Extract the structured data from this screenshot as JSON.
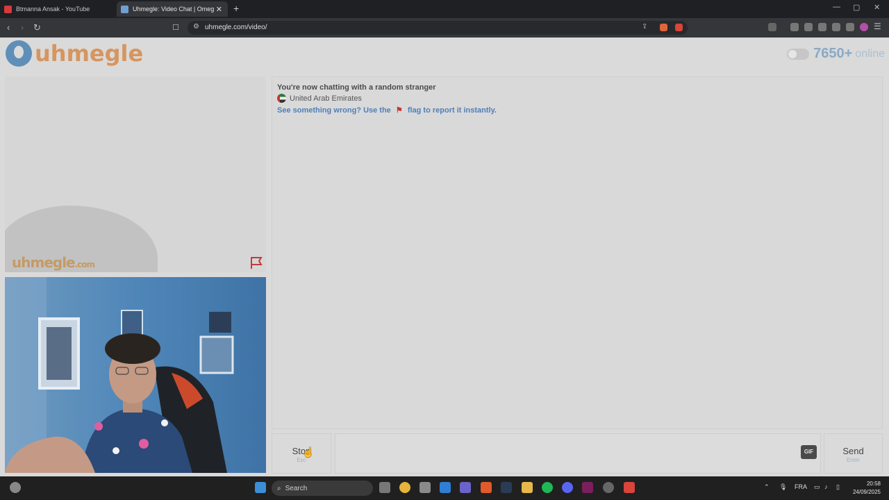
{
  "browser": {
    "tabs": [
      {
        "label": "Btmanna Ansak - YouTube",
        "active": false
      },
      {
        "label": "Uhmegle: Video Chat | Omeg",
        "active": true
      }
    ],
    "url": "uhmegle.com/video/"
  },
  "site": {
    "logo_text": "uhmegle",
    "online_count": "7650+",
    "online_label": "online",
    "watermark": "uhmegle",
    "watermark_suffix": ".com"
  },
  "chat": {
    "status": "You're now chatting with a random stranger",
    "country": "United Arab Emirates",
    "report_prefix": "See something wrong? Use the",
    "report_suffix": "flag to report it instantly."
  },
  "controls": {
    "stop_label": "Stop",
    "stop_hint": "Esc",
    "gif_label": "GIF",
    "send_label": "Send",
    "send_hint": "Enter"
  },
  "taskbar": {
    "search_label": "Search",
    "lang": "FRA",
    "time": "20:58",
    "date": "24/09/2025"
  },
  "colors": {
    "brand_orange": "#d7955f",
    "link_blue": "#4f7fb6",
    "online_blue": "#8aa9c6"
  }
}
